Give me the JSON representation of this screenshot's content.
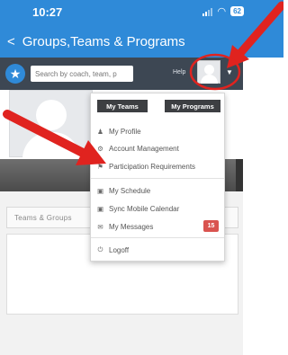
{
  "status": {
    "time": "10:27",
    "battery": "62"
  },
  "nav": {
    "back": "<",
    "title": "Groups,Teams & Programs"
  },
  "header": {
    "search_placeholder": "Search by coach, team, p",
    "help": "Help"
  },
  "menu": {
    "my_teams": "My Teams",
    "my_programs": "My Programs",
    "items": [
      {
        "icon": "user-icon",
        "label": "My Profile"
      },
      {
        "icon": "gear-icon",
        "label": "Account Management"
      },
      {
        "icon": "flag-icon",
        "label": "Participation Requirements"
      },
      {
        "icon": "calendar-icon",
        "label": "My Schedule"
      },
      {
        "icon": "calendar-icon",
        "label": "Sync Mobile Calendar"
      },
      {
        "icon": "envelope-icon",
        "label": "My Messages",
        "badge": "15"
      },
      {
        "icon": "power-icon",
        "label": "Logoff"
      }
    ]
  },
  "content": {
    "tab_label": "Teams & Groups"
  },
  "colors": {
    "nav_blue": "#2f8ad8",
    "header_dark": "#3d4753",
    "annotation_red": "#e0231f",
    "badge_red": "#d9534f"
  }
}
